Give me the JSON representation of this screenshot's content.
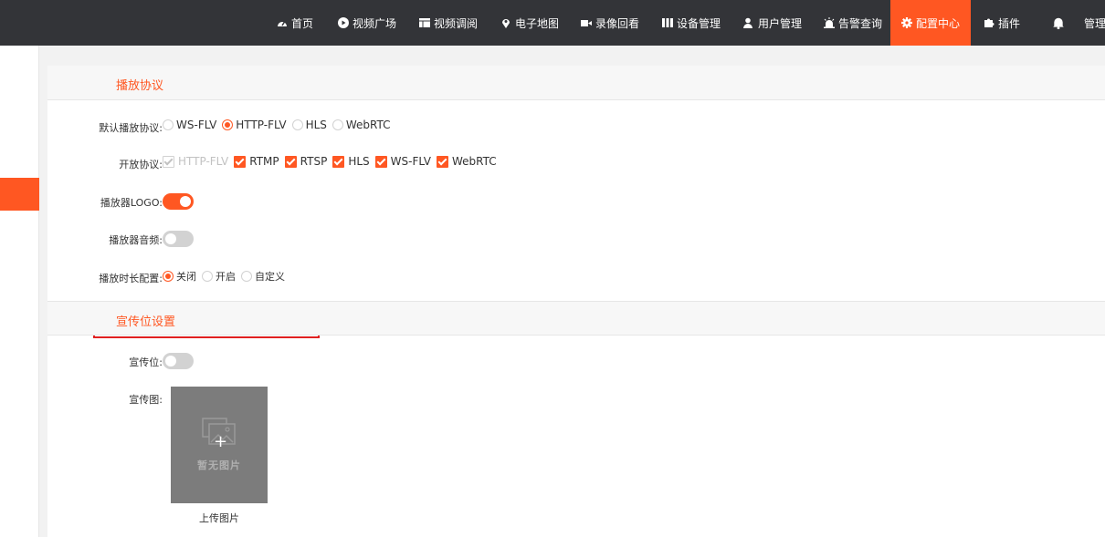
{
  "nav": {
    "items": [
      {
        "label": "首页",
        "icon": "dashboard-icon"
      },
      {
        "label": "视频广场",
        "icon": "play-icon"
      },
      {
        "label": "视频调阅",
        "icon": "table-icon"
      },
      {
        "label": "电子地图",
        "icon": "map-marker-icon"
      },
      {
        "label": "录像回看",
        "icon": "video-camera-icon"
      },
      {
        "label": "设备管理",
        "icon": "columns-icon"
      },
      {
        "label": "用户管理",
        "icon": "users-icon"
      },
      {
        "label": "告警查询",
        "icon": "alarm-icon"
      },
      {
        "label": "配置中心",
        "icon": "gear-icon",
        "active": true
      },
      {
        "label": "插件",
        "icon": "puzzle-icon"
      },
      {
        "label": "",
        "icon": "bell-icon"
      },
      {
        "label": "管理"
      }
    ]
  },
  "section1": {
    "title": "播放协议",
    "default_protocol": {
      "label": "默认播放协议:",
      "options": [
        "WS-FLV",
        "HTTP-FLV",
        "HLS",
        "WebRTC"
      ],
      "selected": "HTTP-FLV"
    },
    "open_protocols": {
      "label": "开放协议:",
      "options": [
        "HTTP-FLV",
        "RTMP",
        "RTSP",
        "HLS",
        "WS-FLV",
        "WebRTC"
      ]
    },
    "player_logo": {
      "label": "播放器LOGO:",
      "state": "on"
    },
    "player_audio": {
      "label": "播放器音频:",
      "state": "off"
    },
    "duration": {
      "label": "播放时长配置:",
      "options": [
        "关闭",
        "开启",
        "自定义"
      ],
      "selected": "关闭"
    }
  },
  "section2": {
    "title": "宣传位设置",
    "ad_slot": {
      "label": "宣传位:",
      "state": "off"
    },
    "ad_image": {
      "label": "宣传图:",
      "placeholder": "暂无图片",
      "upload_label": "上传图片"
    }
  },
  "colors": {
    "accent": "#ff5722",
    "topbar": "#333438",
    "highlight": "#e02020"
  }
}
